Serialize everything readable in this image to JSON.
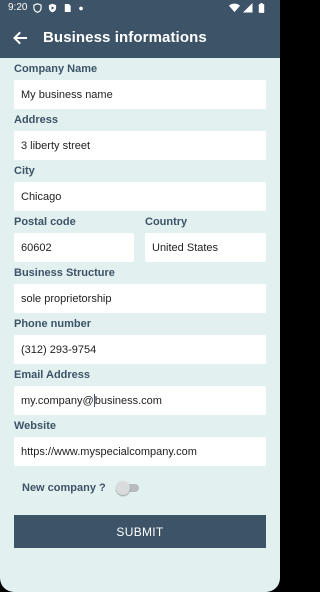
{
  "status_bar": {
    "time": "9:20",
    "left_icons": [
      "shield-status-icon",
      "play-protect-icon",
      "sim-card-icon",
      "notification-dot-icon"
    ],
    "right_icons": [
      "wifi-icon",
      "signal-icon",
      "battery-icon"
    ]
  },
  "app_bar": {
    "back_icon": "arrow-back-icon",
    "title": "Business informations"
  },
  "form": {
    "company_name": {
      "label": "Company Name",
      "value": "My business name"
    },
    "address": {
      "label": "Address",
      "value": "3 liberty street"
    },
    "city": {
      "label": "City",
      "value": "Chicago"
    },
    "postal_code": {
      "label": "Postal code",
      "value": "60602"
    },
    "country": {
      "label": "Country",
      "value": "United States"
    },
    "business_structure": {
      "label": "Business Structure",
      "value": "sole proprietorship"
    },
    "phone": {
      "label": "Phone number",
      "value": "(312) 293-9754"
    },
    "email": {
      "label": "Email Address",
      "value_before_cursor": "my.company@",
      "value_after_cursor": "business.com"
    },
    "website": {
      "label": "Website",
      "value": "https://www.myspecialcompany.com"
    },
    "new_company": {
      "label": "New company ?",
      "checked": false
    },
    "submit_label": "SUBMIT"
  },
  "colors": {
    "primary": "#3d5367",
    "background": "#e2f1f0",
    "field": "#ffffff"
  }
}
